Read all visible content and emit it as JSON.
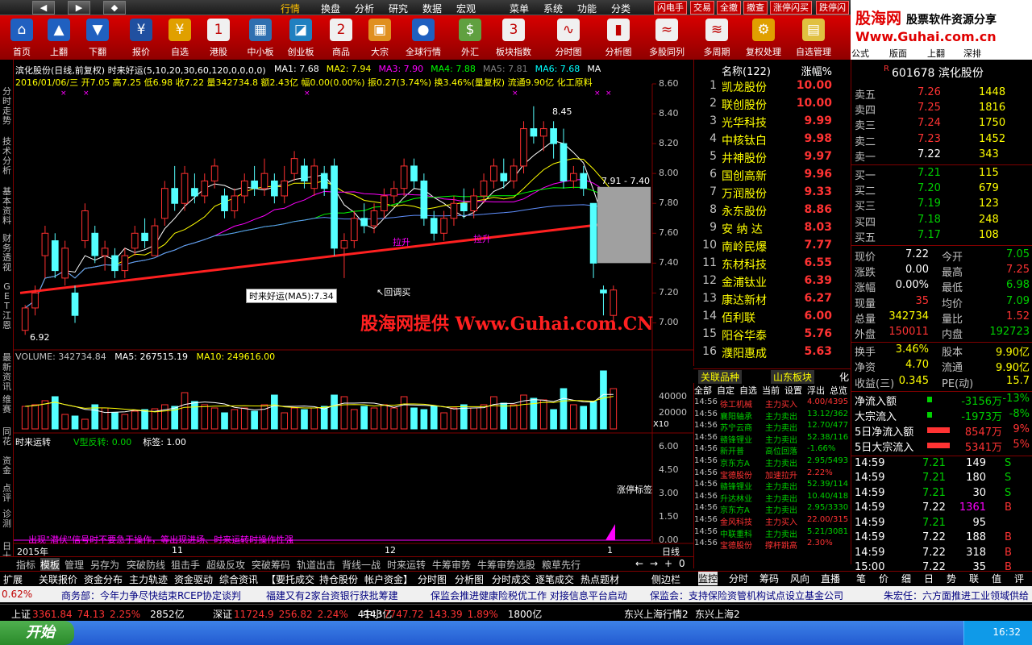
{
  "menu": {
    "nav": [
      "◀",
      "▶",
      "◆"
    ],
    "items": [
      "行情",
      "换盘",
      "分析",
      "研究",
      "数据",
      "宏观",
      "菜单",
      "系统",
      "功能",
      "分类"
    ],
    "trade": [
      "闪电手",
      "交易",
      "全撤",
      "撤查",
      "涨停闪买",
      "跌停闪"
    ]
  },
  "toolbar": [
    {
      "label": "首页",
      "icon": "home-icon",
      "glyph": "⌂",
      "color": "#2060c0"
    },
    {
      "label": "上翻",
      "icon": "arrow-up-icon",
      "glyph": "▲",
      "color": "#2060c0"
    },
    {
      "label": "下翻",
      "icon": "arrow-down-icon",
      "glyph": "▼",
      "color": "#2060c0"
    },
    {
      "label": "报价",
      "icon": "yen-icon",
      "glyph": "¥",
      "color": "#2050a0"
    },
    {
      "label": "自选",
      "icon": "yen-icon",
      "glyph": "¥",
      "color": "#e0a000"
    },
    {
      "label": "港股",
      "icon": "calendar-icon",
      "glyph": "1",
      "color": "#f0f0f0"
    },
    {
      "label": "中小板",
      "icon": "window-icon",
      "glyph": "▦",
      "color": "#3070b0"
    },
    {
      "label": "创业板",
      "icon": "chart-icon",
      "glyph": "◪",
      "color": "#2080c0"
    },
    {
      "label": "商品",
      "icon": "calendar-icon",
      "glyph": "2",
      "color": "#f0f0f0"
    },
    {
      "label": "大宗",
      "icon": "box-icon",
      "glyph": "▣",
      "color": "#e09020"
    },
    {
      "label": "全球行情",
      "icon": "globe-icon",
      "glyph": "●",
      "color": "#2060c0"
    },
    {
      "label": "外汇",
      "icon": "money-icon",
      "glyph": "$",
      "color": "#60a040"
    },
    {
      "label": "板块指数",
      "icon": "calendar-icon",
      "glyph": "3",
      "color": "#f0f0f0"
    },
    {
      "label": "分时图",
      "icon": "line-chart-icon",
      "glyph": "∿",
      "color": "#f0f0f0"
    },
    {
      "label": "分析图",
      "icon": "candle-icon",
      "glyph": "▮",
      "color": "#f0f0f0"
    },
    {
      "label": "多股同列",
      "icon": "wave-icon",
      "glyph": "≈",
      "color": "#f0f0f0"
    },
    {
      "label": "多周期",
      "icon": "wave-icon",
      "glyph": "≋",
      "color": "#f0f0f0"
    },
    {
      "label": "复权处理",
      "icon": "gear-icon",
      "glyph": "⚙",
      "color": "#e0a000"
    },
    {
      "label": "自选管理",
      "icon": "folder-icon",
      "glyph": "▤",
      "color": "#e0c040"
    }
  ],
  "toolbar_extra": [
    "公式",
    "版面",
    "上翻",
    "深排"
  ],
  "logo": {
    "line1": "股海网",
    "line1b": "股票软件资源分享",
    "line2": "Www.Guhai.com.cn"
  },
  "left_tabs": [
    "分时走势",
    "技术分析",
    "基本资料",
    "财务透视",
    "GET江恩",
    "最新资讯",
    "维赛",
    "同花",
    "资金",
    "点评",
    "诊测",
    "日十"
  ],
  "chart": {
    "header": "滨化股份(日线,前复权) 时来好运(5,10,20,30,60,120,0,0,0,0)",
    "ma": [
      {
        "t": "MA1: 7.68",
        "c": "#ffffff"
      },
      {
        "t": "MA2: 7.94",
        "c": "#ffff00"
      },
      {
        "t": "MA3: 7.90",
        "c": "#ff00ff"
      },
      {
        "t": "MA4: 7.88",
        "c": "#00ff00"
      },
      {
        "t": "MA5: 7.81",
        "c": "#808080"
      },
      {
        "t": "MA6: 7.68",
        "c": "#00ffff"
      },
      {
        "t": "MA",
        "c": "#ffffff"
      }
    ],
    "date_line": "2016/01/06/三 开7.05 高7.25 低6.98 收7.22 量342734.8 额2.43亿 幅0.00(0.00%) 振0.27(3.74%) 换3.46%(量复权) 流通9.90亿 化工原料",
    "price_ticks": [
      "8.60",
      "8.40",
      "8.20",
      "8.00",
      "7.80",
      "7.60",
      "7.40",
      "7.20",
      "7.00"
    ],
    "annotations": {
      "high": "8.45",
      "range": "7.91 - 7.40",
      "low": "6.92",
      "pull1": "拉升",
      "pull2": "拉升",
      "buy": "回调买",
      "tooltip": "时来好运(MA5):7.34"
    },
    "watermark": "股海网提供 Www.Guhai.com.CN",
    "volume": {
      "header": "VOLUME: 342734.84",
      "ma5": "MA5: 267515.19",
      "ma10": "MA10: 249616.00",
      "ticks": [
        "40000",
        "20000"
      ],
      "unit": "X10"
    },
    "indicator": {
      "name": "时来运转",
      "sig": "V型反转: 0.00",
      "mark": "标签: 1.00",
      "ticks": [
        "6.00",
        "4.50",
        "3.00",
        "1.50",
        "0.00"
      ],
      "note": "涨停标签",
      "hint": "出现\"潜伏\"信号时不要急于操作，等出现进场、时来运转时操作性强"
    },
    "xaxis": {
      "year": "2015年",
      "m1": "11",
      "m2": "12",
      "m3": "1",
      "period": "日线"
    }
  },
  "chart_data": {
    "type": "candlestick",
    "ylim": [
      6.9,
      8.6
    ],
    "candles": [
      [
        6.95,
        7.1,
        6.92,
        7.12
      ],
      [
        7.1,
        7.2,
        7.05,
        7.25
      ],
      [
        7.45,
        7.6,
        7.3,
        7.65
      ],
      [
        7.55,
        7.35,
        7.3,
        7.6
      ],
      [
        7.3,
        7.5,
        7.25,
        7.55
      ],
      [
        7.2,
        7.05,
        7.0,
        7.25
      ],
      [
        7.55,
        7.75,
        7.5,
        7.8
      ],
      [
        7.6,
        7.45,
        7.4,
        7.65
      ],
      [
        7.45,
        7.5,
        7.35,
        7.55
      ],
      [
        7.45,
        7.35,
        7.3,
        7.5
      ],
      [
        7.35,
        7.45,
        7.3,
        7.5
      ],
      [
        7.5,
        7.6,
        7.45,
        7.65
      ],
      [
        7.6,
        7.55,
        7.5,
        7.7
      ],
      [
        7.45,
        7.65,
        7.45,
        7.7
      ],
      [
        7.7,
        7.9,
        7.65,
        7.95
      ],
      [
        7.9,
        7.8,
        7.75,
        8.05
      ],
      [
        7.8,
        8.0,
        7.75,
        8.05
      ],
      [
        7.9,
        7.85,
        7.8,
        8.0
      ],
      [
        7.85,
        7.95,
        7.8,
        8.0
      ],
      [
        7.95,
        8.05,
        7.9,
        8.1
      ],
      [
        7.85,
        7.75,
        7.7,
        7.9
      ],
      [
        7.75,
        7.85,
        7.7,
        7.9
      ],
      [
        7.85,
        7.95,
        7.8,
        8.0
      ],
      [
        7.95,
        7.9,
        7.85,
        8.05
      ],
      [
        7.9,
        8.0,
        7.85,
        8.1
      ],
      [
        7.95,
        7.85,
        7.8,
        8.0
      ],
      [
        7.85,
        7.95,
        7.8,
        8.05
      ],
      [
        8.0,
        8.1,
        7.95,
        8.15
      ],
      [
        8.05,
        7.95,
        7.9,
        8.1
      ],
      [
        7.9,
        8.05,
        7.85,
        8.1
      ],
      [
        8.0,
        7.9,
        7.85,
        8.05
      ],
      [
        8.05,
        7.5,
        7.45,
        8.1
      ],
      [
        7.5,
        7.55,
        7.3,
        7.6
      ],
      [
        7.55,
        7.7,
        7.5,
        7.75
      ],
      [
        7.7,
        7.65,
        7.6,
        7.8
      ],
      [
        7.65,
        7.75,
        7.6,
        7.8
      ],
      [
        7.75,
        7.85,
        7.7,
        7.9
      ],
      [
        7.85,
        7.9,
        7.8,
        7.95
      ],
      [
        7.9,
        8.05,
        7.85,
        8.1
      ],
      [
        8.05,
        7.95,
        7.9,
        8.1
      ],
      [
        7.95,
        7.7,
        7.65,
        8.0
      ],
      [
        7.7,
        7.6,
        7.55,
        7.75
      ],
      [
        7.6,
        7.7,
        7.55,
        7.75
      ],
      [
        7.7,
        7.8,
        7.65,
        7.85
      ],
      [
        7.8,
        7.75,
        7.7,
        7.9
      ],
      [
        7.75,
        7.85,
        7.7,
        7.9
      ],
      [
        7.85,
        7.95,
        7.8,
        8.0
      ],
      [
        7.95,
        8.05,
        7.9,
        8.1
      ],
      [
        8.0,
        7.95,
        7.9,
        8.1
      ],
      [
        7.95,
        8.05,
        7.9,
        8.1
      ],
      [
        8.05,
        8.3,
        8.0,
        8.35
      ],
      [
        8.3,
        8.25,
        8.2,
        8.45
      ],
      [
        8.25,
        8.3,
        8.15,
        8.35
      ],
      [
        8.3,
        8.2,
        8.1,
        8.35
      ],
      [
        8.2,
        7.95,
        7.9,
        8.3
      ],
      [
        7.95,
        8.0,
        7.9,
        8.05
      ],
      [
        8.0,
        7.9,
        7.85,
        8.05
      ],
      [
        7.8,
        7.4,
        7.3,
        7.8
      ],
      [
        7.22,
        7.2,
        7.05,
        7.25
      ],
      [
        7.05,
        7.22,
        6.98,
        7.25
      ]
    ],
    "volume": [
      28,
      30,
      35,
      40,
      18,
      16,
      12,
      30,
      26,
      20,
      18,
      22,
      24,
      25,
      30,
      28,
      45,
      34,
      30,
      26,
      20,
      24,
      26,
      22,
      30,
      42,
      20,
      26,
      24,
      26,
      28,
      42,
      40,
      24,
      28,
      26,
      30,
      26,
      40,
      26,
      24,
      28,
      20,
      26,
      30,
      26,
      30,
      40,
      32,
      30,
      42,
      38,
      36,
      24,
      50,
      30,
      28,
      34,
      72,
      50
    ]
  },
  "stocklist": {
    "header": {
      "name": "名称(122)",
      "pct": "涨幅%"
    },
    "rows": [
      {
        "n": "1",
        "name": "凯龙股份",
        "v": "10.00"
      },
      {
        "n": "2",
        "name": "联创股份",
        "v": "10.00"
      },
      {
        "n": "3",
        "name": "光华科技",
        "v": "9.99"
      },
      {
        "n": "4",
        "name": "中核钛白",
        "v": "9.98"
      },
      {
        "n": "5",
        "name": "井神股份",
        "v": "9.97"
      },
      {
        "n": "6",
        "name": "国创高新",
        "v": "9.96"
      },
      {
        "n": "7",
        "name": "万润股份",
        "v": "9.33"
      },
      {
        "n": "8",
        "name": "永东股份",
        "v": "8.86"
      },
      {
        "n": "9",
        "name": "安 纳 达",
        "v": "8.03"
      },
      {
        "n": "10",
        "name": "南岭民爆",
        "v": "7.77"
      },
      {
        "n": "11",
        "name": "东材科技",
        "v": "6.55"
      },
      {
        "n": "12",
        "name": "金浦钛业",
        "v": "6.39"
      },
      {
        "n": "13",
        "name": "康达新材",
        "v": "6.27"
      },
      {
        "n": "14",
        "name": "佰利联",
        "v": "6.00"
      },
      {
        "n": "15",
        "name": "阳谷华泰",
        "v": "5.76"
      },
      {
        "n": "16",
        "name": "濮阳惠成",
        "v": "5.63"
      }
    ],
    "tabs": [
      "关联品种",
      "山东板块",
      "化"
    ]
  },
  "tape": {
    "header": [
      "全部",
      "自定",
      "自选",
      "当前",
      "设置",
      "浮出",
      "总览"
    ],
    "rows": [
      {
        "t": "14:56",
        "s": "徐工机械",
        "a": "主力买入",
        "v": "4.00/4395",
        "c": "#ff3333"
      },
      {
        "t": "14:56",
        "s": "襄阳轴承",
        "a": "主力卖出",
        "v": "13.12/362",
        "c": "#00d000"
      },
      {
        "t": "14:56",
        "s": "苏宁云商",
        "a": "主力卖出",
        "v": "12.70/477",
        "c": "#00d000"
      },
      {
        "t": "14:56",
        "s": "赣锋锂业",
        "a": "主力卖出",
        "v": "52.38/116",
        "c": "#00d000"
      },
      {
        "t": "14:56",
        "s": "新开普",
        "a": "高位回落",
        "v": "-1.66%",
        "c": "#00d000"
      },
      {
        "t": "14:56",
        "s": "京东方A",
        "a": "主力卖出",
        "v": "2.95/5493",
        "c": "#00d000"
      },
      {
        "t": "14:56",
        "s": "宝德股份",
        "a": "加速拉升",
        "v": "2.22%",
        "c": "#ff3333"
      },
      {
        "t": "14:56",
        "s": "赣锋锂业",
        "a": "主力卖出",
        "v": "52.39/114",
        "c": "#00d000"
      },
      {
        "t": "14:56",
        "s": "升达林业",
        "a": "主力卖出",
        "v": "10.40/418",
        "c": "#00d000"
      },
      {
        "t": "14:56",
        "s": "京东方A",
        "a": "主力卖出",
        "v": "2.95/3330",
        "c": "#00d000"
      },
      {
        "t": "14:56",
        "s": "金风科技",
        "a": "主力买入",
        "v": "22.00/315",
        "c": "#ff3333"
      },
      {
        "t": "14:56",
        "s": "中联重科",
        "a": "主力卖出",
        "v": "5.21/3081",
        "c": "#00d000"
      },
      {
        "t": "14:56",
        "s": "宝德股份",
        "a": "撑杆跳高",
        "v": "2.30%",
        "c": "#ff3333"
      }
    ]
  },
  "quote": {
    "code": "R",
    "title": "601678 滨化股份",
    "asks": [
      {
        "l": "卖五",
        "p": "7.26",
        "v": "1448"
      },
      {
        "l": "卖四",
        "p": "7.25",
        "v": "1816"
      },
      {
        "l": "卖三",
        "p": "7.24",
        "v": "1750"
      },
      {
        "l": "卖二",
        "p": "7.23",
        "v": "1452"
      },
      {
        "l": "卖一",
        "p": "7.22",
        "v": "343"
      }
    ],
    "bids": [
      {
        "l": "买一",
        "p": "7.21",
        "v": "115"
      },
      {
        "l": "买二",
        "p": "7.20",
        "v": "679"
      },
      {
        "l": "买三",
        "p": "7.19",
        "v": "123"
      },
      {
        "l": "买四",
        "p": "7.18",
        "v": "248"
      },
      {
        "l": "买五",
        "p": "7.17",
        "v": "108"
      }
    ],
    "stats": [
      {
        "a": "现价",
        "av": "7.22",
        "ac": "#ffffff",
        "b": "今开",
        "bv": "7.05",
        "bc": "#00d000"
      },
      {
        "a": "涨跌",
        "av": "0.00",
        "ac": "#ffffff",
        "b": "最高",
        "bv": "7.25",
        "bc": "#ff3333"
      },
      {
        "a": "涨幅",
        "av": "0.00%",
        "ac": "#ffffff",
        "b": "最低",
        "bv": "6.98",
        "bc": "#00d000"
      },
      {
        "a": "现量",
        "av": "35",
        "ac": "#ff3333",
        "b": "均价",
        "bv": "7.09",
        "bc": "#00d000"
      },
      {
        "a": "总量",
        "av": "342734",
        "ac": "#ffff00",
        "b": "量比",
        "bv": "1.52",
        "bc": "#ff3333"
      },
      {
        "a": "外盘",
        "av": "150011",
        "ac": "#ff3333",
        "b": "内盘",
        "bv": "192723",
        "bc": "#00d000"
      }
    ],
    "stats2": [
      {
        "a": "换手",
        "av": "3.46%",
        "ac": "#ffff00",
        "b": "股本",
        "bv": "9.90亿",
        "bc": "#ffff00"
      },
      {
        "a": "净资",
        "av": "4.70",
        "ac": "#ffff00",
        "b": "流通",
        "bv": "9.90亿",
        "bc": "#ffff00"
      },
      {
        "a": "收益(三)",
        "av": "0.345",
        "ac": "#ffff00",
        "b": "PE(动)",
        "bv": "15.7",
        "bc": "#ffff00"
      }
    ],
    "flow": [
      {
        "l": "净流入额",
        "v": "-3156万",
        "p": "-13%",
        "c": "#00d000"
      },
      {
        "l": "大宗流入",
        "v": "-1973万",
        "p": "-8%",
        "c": "#00d000"
      },
      {
        "l": "5日净流入额",
        "v": "8547万",
        "p": "9%",
        "c": "#ff3333"
      },
      {
        "l": "5日大宗流入",
        "v": "5341万",
        "p": "5%",
        "c": "#ff3333"
      }
    ],
    "ticks": [
      {
        "t": "14:59",
        "p": "7.21",
        "v": "149",
        "s": "S"
      },
      {
        "t": "14:59",
        "p": "7.21",
        "v": "180",
        "s": "S"
      },
      {
        "t": "14:59",
        "p": "7.21",
        "v": "30",
        "s": "S"
      },
      {
        "t": "14:59",
        "p": "7.22",
        "v": "1361",
        "s": "B"
      },
      {
        "t": "14:59",
        "p": "7.21",
        "v": "95",
        "s": ""
      },
      {
        "t": "14:59",
        "p": "7.22",
        "v": "188",
        "s": "B"
      },
      {
        "t": "14:59",
        "p": "7.22",
        "v": "318",
        "s": "B"
      },
      {
        "t": "15:00",
        "p": "7.22",
        "v": "35",
        "s": "B"
      }
    ],
    "tabs": [
      "监控",
      "分时",
      "筹码",
      "风向",
      "直播",
      "笔",
      "价",
      "细",
      "日",
      "势",
      "联",
      "值",
      "评"
    ]
  },
  "bottom_tabs": [
    "指标",
    "模板",
    "管理",
    "另存为",
    "突破防线",
    "狙击手",
    "超级反攻",
    "突破筹码",
    "轨道出击",
    "背线一战",
    "时来运转",
    "牛筹审势",
    "牛筹审势选股",
    "粮草先行"
  ],
  "nav_btns": [
    "←",
    "→",
    "+",
    "0"
  ],
  "func_tabs": [
    "扩展",
    "关联报价",
    "资金分布",
    "主力轨迹",
    "资金驱动",
    "综合资讯",
    "【要托成交",
    "持仓股份",
    "帐户资金】",
    "分时图",
    "分析图",
    "分时成交",
    "逐笔成交",
    "热点题材",
    "侧边栏"
  ],
  "news": [
    "0.62%",
    "商务部：今年力争尽快结束RCEP协定谈判",
    "福建又有2家台资银行获批筹建",
    "保监会推进健康险税优工作 对接信息平台启动",
    "保监会：支持保险资管机构试点设立基金公司",
    "朱宏任：六方面推进工业领域供给"
  ],
  "index": [
    {
      "n": "上证",
      "v": "3361.84",
      "c": "74.13",
      "p": "2.25%",
      "a": "2852亿"
    },
    {
      "n": "深证",
      "v": "11724.9",
      "c": "256.82",
      "p": "2.24%",
      "a": "4143亿"
    },
    {
      "n": "中小",
      "v": "7747.72",
      "c": "143.39",
      "p": "1.89%",
      "a": "1800亿"
    }
  ],
  "index_extra": [
    "东兴上海行情2",
    "东兴上海2"
  ],
  "taskbar": {
    "start": "开始",
    "clock": "16:32"
  }
}
